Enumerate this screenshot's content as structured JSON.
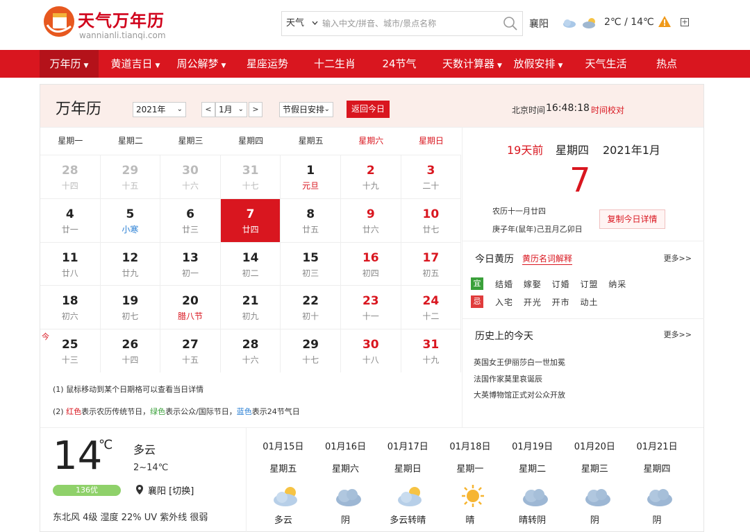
{
  "brand": {
    "title": "天气万年历",
    "subtitle": "wannianli.tianqi.com"
  },
  "search": {
    "type": "天气",
    "placeholder": "输入中文/拼音、城市/景点名称"
  },
  "topweather": {
    "city": "襄阳",
    "temp": "2℃ / 14℃"
  },
  "nav": [
    {
      "label": "万年历",
      "dropdown": true
    },
    {
      "label": "黄道吉日",
      "dropdown": true
    },
    {
      "label": "周公解梦",
      "dropdown": true
    },
    {
      "label": "星座运势",
      "dropdown": false
    },
    {
      "label": "十二生肖",
      "dropdown": false
    },
    {
      "label": "24节气",
      "dropdown": false
    },
    {
      "label": "天数计算器",
      "dropdown": true
    },
    {
      "label": "放假安排",
      "dropdown": true
    },
    {
      "label": "天气生活",
      "dropdown": false
    },
    {
      "label": "热点",
      "dropdown": false
    }
  ],
  "toolbar": {
    "title": "万年历",
    "year": "2021年",
    "month": "1月",
    "prev": "<",
    "next": ">",
    "holiday": "节假日安排",
    "today_btn": "返回今日",
    "bj_label": "北京时间",
    "bj_time": "16:48:18",
    "time_check": "时间校对"
  },
  "weekdays": [
    "星期一",
    "星期二",
    "星期三",
    "星期四",
    "星期五",
    "星期六",
    "星期日"
  ],
  "calendar": [
    [
      {
        "d": "28",
        "l": "十四",
        "t": "prev"
      },
      {
        "d": "29",
        "l": "十五",
        "t": "prev"
      },
      {
        "d": "30",
        "l": "十六",
        "t": "prev"
      },
      {
        "d": "31",
        "l": "十七",
        "t": "prev"
      },
      {
        "d": "1",
        "l": "元旦",
        "t": "fest"
      },
      {
        "d": "2",
        "l": "十九",
        "t": ""
      },
      {
        "d": "3",
        "l": "二十",
        "t": ""
      }
    ],
    [
      {
        "d": "4",
        "l": "廿一",
        "t": ""
      },
      {
        "d": "5",
        "l": "小寒",
        "t": "term"
      },
      {
        "d": "6",
        "l": "廿三",
        "t": ""
      },
      {
        "d": "7",
        "l": "廿四",
        "t": "selected"
      },
      {
        "d": "8",
        "l": "廿五",
        "t": ""
      },
      {
        "d": "9",
        "l": "廿六",
        "t": ""
      },
      {
        "d": "10",
        "l": "廿七",
        "t": ""
      }
    ],
    [
      {
        "d": "11",
        "l": "廿八",
        "t": ""
      },
      {
        "d": "12",
        "l": "廿九",
        "t": ""
      },
      {
        "d": "13",
        "l": "初一",
        "t": ""
      },
      {
        "d": "14",
        "l": "初二",
        "t": ""
      },
      {
        "d": "15",
        "l": "初三",
        "t": ""
      },
      {
        "d": "16",
        "l": "初四",
        "t": ""
      },
      {
        "d": "17",
        "l": "初五",
        "t": ""
      }
    ],
    [
      {
        "d": "18",
        "l": "初六",
        "t": ""
      },
      {
        "d": "19",
        "l": "初七",
        "t": ""
      },
      {
        "d": "20",
        "l": "腊八节",
        "t": "fest"
      },
      {
        "d": "21",
        "l": "初九",
        "t": ""
      },
      {
        "d": "22",
        "l": "初十",
        "t": ""
      },
      {
        "d": "23",
        "l": "十一",
        "t": ""
      },
      {
        "d": "24",
        "l": "十二",
        "t": ""
      }
    ],
    [
      {
        "d": "25",
        "l": "十三",
        "t": "today"
      },
      {
        "d": "26",
        "l": "十四",
        "t": ""
      },
      {
        "d": "27",
        "l": "十五",
        "t": ""
      },
      {
        "d": "28",
        "l": "十六",
        "t": ""
      },
      {
        "d": "29",
        "l": "十七",
        "t": ""
      },
      {
        "d": "30",
        "l": "十八",
        "t": ""
      },
      {
        "d": "31",
        "l": "十九",
        "t": ""
      }
    ]
  ],
  "today_tag": "今",
  "notes": {
    "n1": "(1) 鼠标移动到某个日期格可以查看当日详情",
    "n2_pre": "(2) ",
    "n2_red": "红色",
    "n2_a": "表示农历传统节日，",
    "n2_green": "绿色",
    "n2_b": "表示公众/国际节日，",
    "n2_blue": "蓝色",
    "n2_c": "表示24节气日"
  },
  "detail": {
    "days_ago": "19天前",
    "weekday": "星期四",
    "month": "2021年1月",
    "day": "7",
    "lunar1": "农历十一月廿四",
    "lunar2": "庚子年(鼠年)己丑月乙卯日",
    "copy_btn": "复制今日详情"
  },
  "huangli": {
    "title": "今日黄历",
    "link": "黄历名词解释",
    "more": "更多>>",
    "yi_tag": "宜",
    "yi": "结婚 嫁娶 订婚 订盟 纳采",
    "ji_tag": "忌",
    "ji": "入宅 开光 开市 动土"
  },
  "history": {
    "title": "历史上的今天",
    "more": "更多>>",
    "items": [
      "英国女王伊丽莎白一世加冕",
      "法国作家莫里哀诞辰",
      "大英博物馆正式对公众开放"
    ]
  },
  "current_weather": {
    "temp": "14",
    "unit": "℃",
    "cond": "多云",
    "range": "2~14℃",
    "aqi": "136优",
    "city": "襄阳 [切换]",
    "extra": "东北风 4级  湿度 22%  UV 紫外线 很弱"
  },
  "forecast": [
    {
      "date": "01月15日",
      "weekday": "星期五",
      "cond": "多云",
      "icon": "partly-cloudy-icon"
    },
    {
      "date": "01月16日",
      "weekday": "星期六",
      "cond": "阴",
      "icon": "cloudy-icon"
    },
    {
      "date": "01月17日",
      "weekday": "星期日",
      "cond": "多云转晴",
      "icon": "partly-cloudy-icon"
    },
    {
      "date": "01月18日",
      "weekday": "星期一",
      "cond": "晴",
      "icon": "sunny-icon"
    },
    {
      "date": "01月19日",
      "weekday": "星期二",
      "cond": "晴转阴",
      "icon": "cloudy-icon"
    },
    {
      "date": "01月20日",
      "weekday": "星期三",
      "cond": "阴",
      "icon": "cloudy-icon"
    },
    {
      "date": "01月21日",
      "weekday": "星期四",
      "cond": "阴",
      "icon": "cloudy-icon"
    }
  ],
  "colors": {
    "brand_red": "#d9161f",
    "festival_red": "#d9161f",
    "term_blue": "#2a7fd4",
    "yi_green": "#3aa03a",
    "ji_red": "#e03c3c"
  }
}
